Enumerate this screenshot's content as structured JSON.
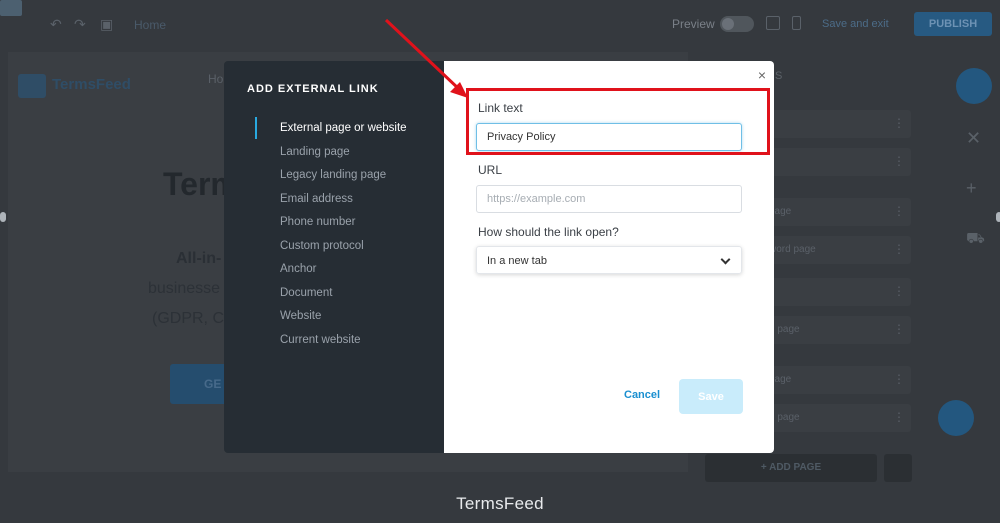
{
  "background": {
    "topbar": {
      "home_label": "Home",
      "preview_label": "Preview",
      "save_exit_label": "Save and exit",
      "publish_label": "PUBLISH"
    },
    "canvas": {
      "logo_text": "TermsFeed",
      "nav_item": "Ho",
      "hero_title": "Term",
      "hero_line1": "All-in-",
      "hero_line2": "businesse",
      "hero_line3": "(GDPR, C",
      "hero_button": "GE"
    },
    "right_panel": {
      "header": "S",
      "items": [
        "",
        "",
        "page",
        "word page",
        "",
        "n page",
        "page",
        "n page"
      ],
      "add_page_label": "+ ADD PAGE"
    }
  },
  "modal": {
    "title": "ADD EXTERNAL LINK",
    "options": [
      "External page or website",
      "Landing page",
      "Legacy landing page",
      "Email address",
      "Phone number",
      "Custom protocol",
      "Anchor",
      "Document",
      "Website",
      "Current website"
    ],
    "active_option": 0,
    "close_glyph": "×",
    "link_text": {
      "label": "Link text",
      "value": "Privacy Policy"
    },
    "url": {
      "label": "URL",
      "placeholder": "https://example.com",
      "value": ""
    },
    "open_mode": {
      "label": "How should the link open?",
      "selected": "In a new tab"
    },
    "cancel_label": "Cancel",
    "save_label": "Save"
  },
  "annotation": {
    "color": "#e0121b"
  },
  "caption": "TermsFeed",
  "colors": {
    "accent": "#29a9e0",
    "link_blue": "#1a8fd0",
    "save_disabled": "#c9ecfb",
    "sidebar_dark": "#262d34"
  },
  "icons": {
    "mail": "mail-icon",
    "undo": "undo-icon",
    "redo": "redo-icon",
    "save_disk": "floppy-icon",
    "desktop": "monitor-icon",
    "mobile": "phone-icon",
    "chevron": "chevron-down-icon",
    "close": "close-icon",
    "plus": "plus-icon",
    "cart": "cart-icon",
    "chat": "chat-icon",
    "stats": "chart-icon"
  }
}
